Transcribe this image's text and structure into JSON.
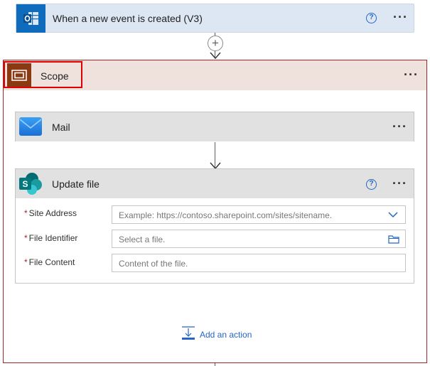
{
  "trigger": {
    "title": "When a new event is created (V3)",
    "icon": "outlook-icon",
    "help": "?",
    "more": "···"
  },
  "connector": {
    "add_step": "+"
  },
  "scope": {
    "title": "Scope",
    "icon": "scope-icon",
    "more": "···",
    "highlight_color": "#e00000"
  },
  "mail": {
    "title": "Mail",
    "icon": "mail-icon",
    "more": "···"
  },
  "update_file": {
    "title": "Update file",
    "icon": "sharepoint-icon",
    "help": "?",
    "more": "···",
    "fields": [
      {
        "label": "Site Address",
        "required": "*",
        "placeholder": "Example: https://contoso.sharepoint.com/sites/sitename.",
        "trailing_icon": "chevron-down-icon"
      },
      {
        "label": "File Identifier",
        "required": "*",
        "placeholder": "Select a file.",
        "trailing_icon": "folder-icon"
      },
      {
        "label": "File Content",
        "required": "*",
        "placeholder": "Content of the file."
      }
    ]
  },
  "add_action": {
    "label": "Add an action",
    "icon": "add-action-icon"
  },
  "colors": {
    "trigger_bg": "#dce7f3",
    "scope_border": "#a4262c",
    "scope_header_bg": "#efe1dc",
    "link": "#2266c7"
  }
}
